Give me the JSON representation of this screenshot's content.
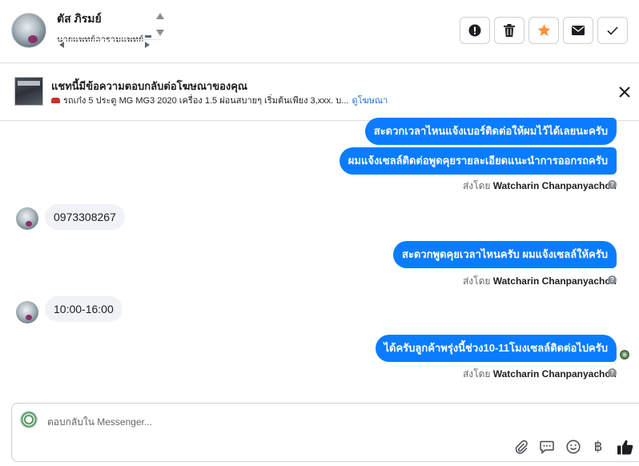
{
  "header": {
    "contact_name": "ตัส ภิรมย์",
    "contact_subtitle": "นายแพทย์อารามแพทย์"
  },
  "ad": {
    "title": "แชทนี้มีข้อความตอบกลับต่อโฆษณาของคุณ",
    "description": "รถเก๋ง 5 ประตู MG MG3 2020 เครื่อง 1.5 ผ่อนสบายๆ เริ่มต้นเพียง 3,xxx. บ...",
    "link_label": "ดูโฆษณา"
  },
  "messages": [
    {
      "direction": "outgoing",
      "text": "สะดวกเวลาไหนแจ้งเบอร์ติดต่อให้ผมไว้ได้เลยนะครับ"
    },
    {
      "direction": "outgoing",
      "text": "ผมแจ้งเซลล์ติดต่อพูดคุยรายละเอียดแนะนำการออกรถครับ"
    },
    {
      "direction": "meta",
      "prefix": "ส่งโดย",
      "sender": "Watcharin Chanpanyachon"
    },
    {
      "direction": "incoming",
      "text": "0973308267"
    },
    {
      "direction": "outgoing",
      "text": "สะดวกพูดคุยเวลาไหนครับ ผมแจ้งเซลล์ให้ครับ"
    },
    {
      "direction": "meta",
      "prefix": "ส่งโดย",
      "sender": "Watcharin Chanpanyachon"
    },
    {
      "direction": "incoming",
      "text": "10:00-16:00"
    },
    {
      "direction": "outgoing",
      "text": "ได้ครับลูกค้าพรุ่งนี้ช่วง10-11โมงเซลล์ติดต่อไปครับ"
    },
    {
      "direction": "meta",
      "prefix": "ส่งโดย",
      "sender": "Watcharin Chanpanyachon"
    }
  ],
  "composer": {
    "placeholder": "ตอบกลับใน Messenger..."
  },
  "icons": {
    "currency_symbol": "฿",
    "help_glyph": "?"
  },
  "colors": {
    "outgoing_bubble": "#0a7cff",
    "incoming_bubble": "#f0f2f5",
    "star": "#f7923a",
    "link": "#216fdb"
  }
}
